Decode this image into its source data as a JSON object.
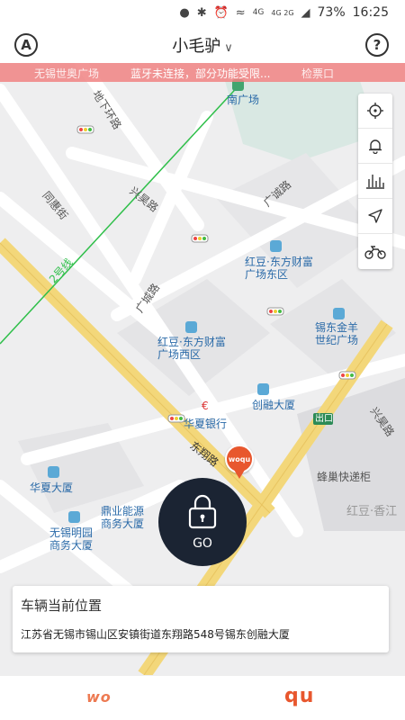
{
  "status_bar": {
    "network": "4G",
    "network2": "4G 2G",
    "battery": "73%",
    "time": "16:25"
  },
  "header": {
    "left_badge": "A",
    "title": "小毛驴",
    "help": "?"
  },
  "banner": {
    "message": "蓝牙未连接，部分功能受限...",
    "left_place": "无锡世奥广场",
    "right_place": "检票口"
  },
  "map_labels": {
    "nan_guangchang": "南广场",
    "dixia_huanlu": "地下环路",
    "tonghui_jie": "同惠街",
    "xinghao_lu": "兴昊路",
    "guangcheng_lu_top": "广诚路",
    "hongdou_dongfang_east": "红豆·东方财富广场东区",
    "guangcheng_lu_left": "广城路",
    "xidong_jinyang": "锡东金羊世纪广场",
    "hongdou_dongfang_west": "红豆·东方财富广场西区",
    "chuangrong_dasha": "创融大厦",
    "huaxia_bank": "华夏银行",
    "dongxiang_lu": "东翔路",
    "chukou": "出口",
    "xinghao_lu_right": "兴昊路",
    "fengchao": "蜂巢快递柜",
    "hongdou_xiangjiang": "红豆·香江",
    "huaxia_dasha": "华夏大厦",
    "dingye_neng": "鼎业能源商务大厦",
    "wuxi_mingyuan": "无锡明园商务大厦",
    "line2": "2号线"
  },
  "icons": {
    "tools": [
      "locate-icon",
      "bell-icon",
      "chart-icon",
      "navigate-icon",
      "motorbike-icon"
    ],
    "lock": "lock-icon"
  },
  "go_button": {
    "label": "GO"
  },
  "location_card": {
    "title": "车辆当前位置",
    "address": "江苏省无锡市锡山区安镇街道东翔路548号锡东创融大厦"
  },
  "marker": {
    "brand": "woqu"
  },
  "tabs": {
    "wo": "wo",
    "qu": "qu"
  },
  "colors": {
    "accent": "#e8572e",
    "go_button": "#1b2433",
    "banner": "#f08282"
  }
}
